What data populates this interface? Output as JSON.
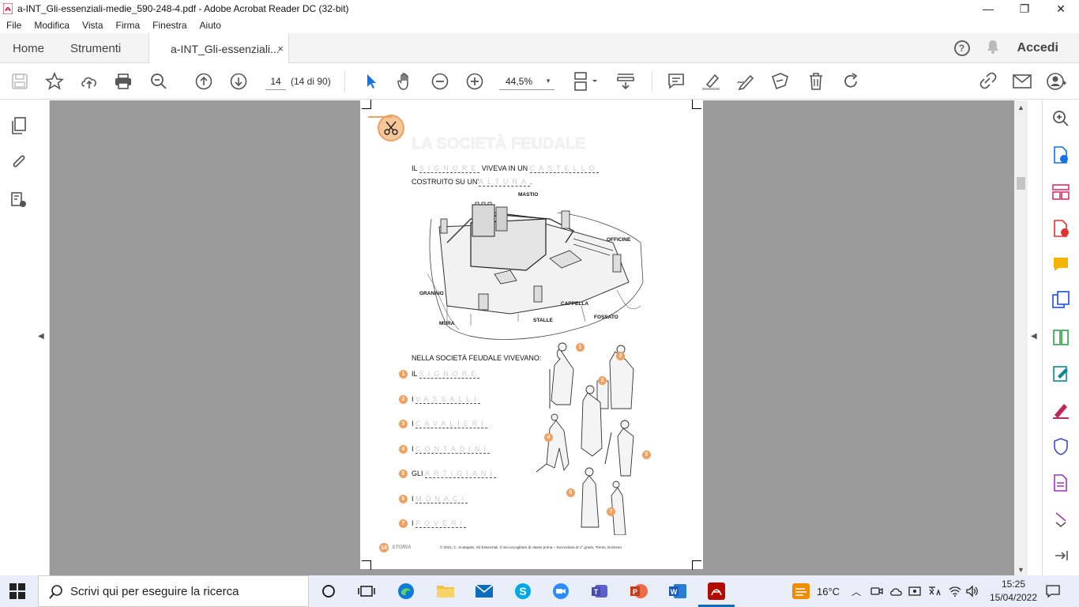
{
  "window": {
    "title": "a-INT_Gli-essenziali-medie_590-248-4.pdf - Adobe Acrobat Reader DC (32-bit)",
    "minimize": "—",
    "maximize": "❐",
    "close": "✕"
  },
  "menu": [
    "File",
    "Modifica",
    "Vista",
    "Firma",
    "Finestra",
    "Aiuto"
  ],
  "tabs": {
    "home": "Home",
    "tools": "Strumenti",
    "document": "a-INT_Gli-essenziali...",
    "close": "×",
    "signin": "Accedi",
    "help": "?"
  },
  "toolbar": {
    "page_number": "14",
    "page_count": "(14 di 90)",
    "zoom": "44,5%"
  },
  "document": {
    "heading": "LA SOCIETÀ FEUDALE",
    "line1_a": "IL",
    "line1_answer": "SIGNORE",
    "line1_b": "VIVEVA IN UN",
    "line1_answer2": "CASTELLO",
    "line2_a": "COSTRUITO SU UN'",
    "line2_answer": "ALTURA",
    "castle_labels": {
      "mastio": "MASTIO",
      "officine": "OFFICINE",
      "granaio": "GRANAIO",
      "cappella": "CAPPELLA",
      "mura": "MURA",
      "stalle": "STALLE",
      "fossato": "FOSSATO"
    },
    "society_title": "NELLA SOCIETÀ FEUDALE VIVEVANO:",
    "roles": [
      {
        "n": "1",
        "article": "IL",
        "answer": "SIGNORE"
      },
      {
        "n": "2",
        "article": "I",
        "answer": "VASSALLI"
      },
      {
        "n": "3",
        "article": "I",
        "answer": "CAVALIERI"
      },
      {
        "n": "4",
        "article": "I",
        "answer": "CONTADINI"
      },
      {
        "n": "5",
        "article": "GLI",
        "answer": "ARTIGIANI"
      },
      {
        "n": "6",
        "article": "I",
        "answer": "MONACI"
      },
      {
        "n": "7",
        "article": "I",
        "answer": "POVERI"
      }
    ],
    "figure_numbers": [
      "1",
      "2",
      "3",
      "4",
      "5",
      "6",
      "7"
    ],
    "footer_page": "14",
    "footer_subject": "STORIA",
    "footer_copyright": "© 2021, C. Scataglini, Gli Essenziali. Il mio accoglitore di classe prima – Secondaria di 1° grado, Trento, Erickson"
  },
  "taskbar": {
    "search_placeholder": "Scrivi qui per eseguire la ricerca",
    "temperature": "16°C",
    "time": "15:25",
    "date": "15/04/2022"
  },
  "colors": {
    "acrobat_red": "#c8102e",
    "accent_blue": "#1473e6",
    "toolbar_icon": "#555555",
    "viewer_bg": "#9b9b9b",
    "answer_ghost": "#cccccc",
    "badge_orange": "#f0a060"
  }
}
